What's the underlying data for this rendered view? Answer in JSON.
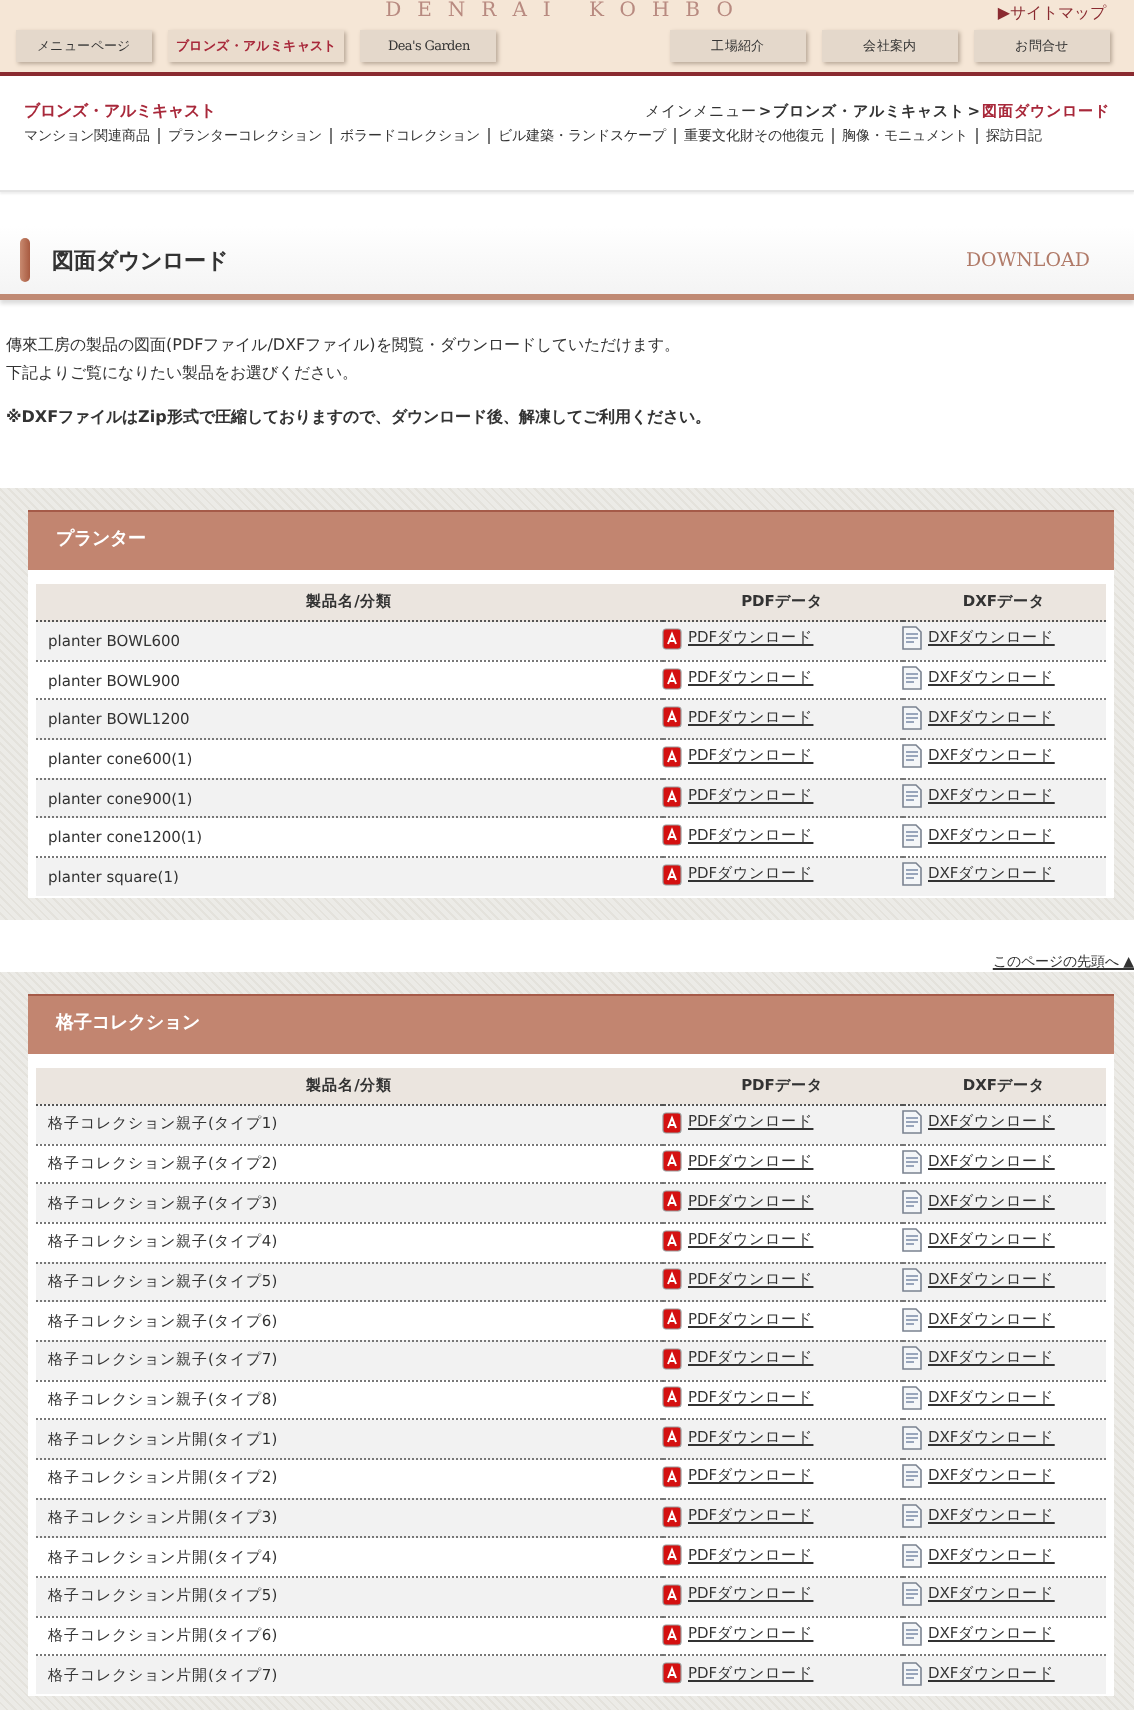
{
  "header": {
    "logo": "DENRAI KOHBO",
    "sitemap": "▶サイトマップ",
    "nav_left": [
      {
        "label": "メニューページ",
        "selected": false
      },
      {
        "label": "ブロンズ・アルミキャスト",
        "selected": true
      },
      {
        "label": "Dea's Garden",
        "selected": false
      }
    ],
    "nav_right": [
      {
        "label": "工場紹介",
        "selected": false
      },
      {
        "label": "会社案内",
        "selected": false
      },
      {
        "label": "お問合せ",
        "selected": false
      }
    ]
  },
  "category": {
    "title": "ブロンズ・アルミキャスト",
    "links": [
      "マンション関連商品",
      "プランターコレクション",
      "ボラードコレクション",
      "ビル建築・ランドスケープ",
      "重要文化財その他復元",
      "胸像・モニュメント",
      "探訪日記"
    ]
  },
  "breadcrumb": {
    "items": [
      "メインメニュー",
      "ブロンズ・アルミキャスト",
      "図面ダウンロード"
    ],
    "separators": [
      ">",
      ">"
    ]
  },
  "page_title": {
    "title": "図面ダウンロード",
    "subtitle": "DOWNLOAD"
  },
  "intro": [
    "傳來工房の製品の図面(PDFファイル/DXFファイル)を閲覧・ダウンロードしていただけます。",
    "下記よりご覧になりたい製品をお選びください。"
  ],
  "note": "※DXFファイルはZip形式で圧縮しておりますので、ダウンロード後、解凍してご利用ください。",
  "sections": [
    {
      "title": "プランター",
      "columns": [
        "製品名/分類",
        "PDFデータ",
        "DXFデータ"
      ],
      "rows": [
        {
          "name": "planter BOWL600",
          "pdf": "PDFダウンロード",
          "dxf": "DXFダウンロード"
        },
        {
          "name": "planter BOWL900",
          "pdf": "PDFダウンロード",
          "dxf": "DXFダウンロード"
        },
        {
          "name": "planter BOWL1200",
          "pdf": "PDFダウンロード",
          "dxf": "DXFダウンロード"
        },
        {
          "name": "planter cone600(1)",
          "pdf": "PDFダウンロード",
          "dxf": "DXFダウンロード"
        },
        {
          "name": "planter cone900(1)",
          "pdf": "PDFダウンロード",
          "dxf": "DXFダウンロード"
        },
        {
          "name": "planter cone1200(1)",
          "pdf": "PDFダウンロード",
          "dxf": "DXFダウンロード"
        },
        {
          "name": "planter square(1)",
          "pdf": "PDFダウンロード",
          "dxf": "DXFダウンロード"
        }
      ],
      "top_link": "このページの先頭へ ▲"
    },
    {
      "title": "格子コレクション",
      "columns": [
        "製品名/分類",
        "PDFデータ",
        "DXFデータ"
      ],
      "rows": [
        {
          "name": "格子コレクション親子(タイプ1)",
          "pdf": "PDFダウンロード",
          "dxf": "DXFダウンロード"
        },
        {
          "name": "格子コレクション親子(タイプ2)",
          "pdf": "PDFダウンロード",
          "dxf": "DXFダウンロード"
        },
        {
          "name": "格子コレクション親子(タイプ3)",
          "pdf": "PDFダウンロード",
          "dxf": "DXFダウンロード"
        },
        {
          "name": "格子コレクション親子(タイプ4)",
          "pdf": "PDFダウンロード",
          "dxf": "DXFダウンロード"
        },
        {
          "name": "格子コレクション親子(タイプ5)",
          "pdf": "PDFダウンロード",
          "dxf": "DXFダウンロード"
        },
        {
          "name": "格子コレクション親子(タイプ6)",
          "pdf": "PDFダウンロード",
          "dxf": "DXFダウンロード"
        },
        {
          "name": "格子コレクション親子(タイプ7)",
          "pdf": "PDFダウンロード",
          "dxf": "DXFダウンロード"
        },
        {
          "name": "格子コレクション親子(タイプ8)",
          "pdf": "PDFダウンロード",
          "dxf": "DXFダウンロード"
        },
        {
          "name": "格子コレクション片開(タイプ1)",
          "pdf": "PDFダウンロード",
          "dxf": "DXFダウンロード"
        },
        {
          "name": "格子コレクション片開(タイプ2)",
          "pdf": "PDFダウンロード",
          "dxf": "DXFダウンロード"
        },
        {
          "name": "格子コレクション片開(タイプ3)",
          "pdf": "PDFダウンロード",
          "dxf": "DXFダウンロード"
        },
        {
          "name": "格子コレクション片開(タイプ4)",
          "pdf": "PDFダウンロード",
          "dxf": "DXFダウンロード"
        },
        {
          "name": "格子コレクション片開(タイプ5)",
          "pdf": "PDFダウンロード",
          "dxf": "DXFダウンロード"
        },
        {
          "name": "格子コレクション片開(タイプ6)",
          "pdf": "PDFダウンロード",
          "dxf": "DXFダウンロード"
        },
        {
          "name": "格子コレクション片開(タイプ7)",
          "pdf": "PDFダウンロード",
          "dxf": "DXFダウンロード"
        }
      ]
    }
  ]
}
